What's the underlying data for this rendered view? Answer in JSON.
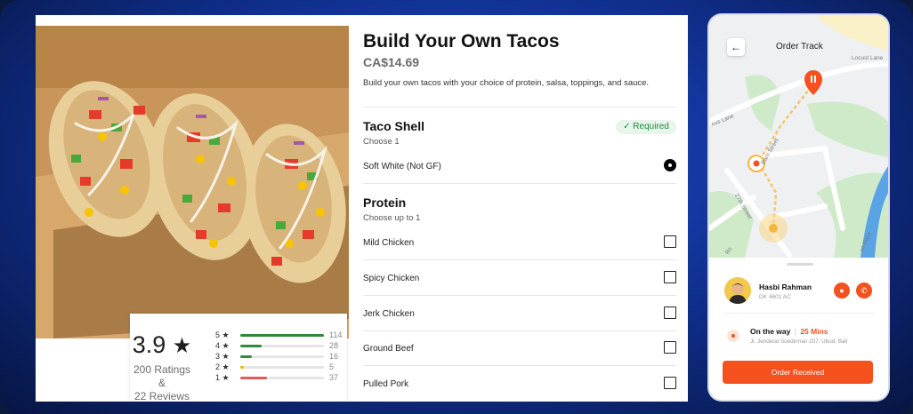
{
  "product": {
    "title": "Build Your Own Tacos",
    "price": "CA$14.69",
    "description": "Build your own tacos with your choice of protein, salsa, toppings, and sauce.",
    "image_icon": "taco-photo"
  },
  "rating": {
    "score": "3.9",
    "star": "★",
    "ratings_text": "200 Ratings &",
    "reviews_text": "22 Reviews",
    "breakdown": [
      {
        "label": "5 ★",
        "count": "114",
        "fraction": 1.0,
        "color": "#2e8b3e"
      },
      {
        "label": "4 ★",
        "count": "28",
        "fraction": 0.25,
        "color": "#2e8b3e"
      },
      {
        "label": "3 ★",
        "count": "16",
        "fraction": 0.14,
        "color": "#2e8b3e"
      },
      {
        "label": "2 ★",
        "count": "5",
        "fraction": 0.04,
        "color": "#f4b400"
      },
      {
        "label": "1 ★",
        "count": "37",
        "fraction": 0.32,
        "color": "#e55b5b"
      }
    ]
  },
  "taco_shell": {
    "title": "Taco Shell",
    "subtitle": "Choose 1",
    "badge": "✓ Required",
    "options": [
      {
        "label": "Soft White (Not GF)",
        "selected": true
      }
    ]
  },
  "protein": {
    "title": "Protein",
    "subtitle": "Choose up to 1",
    "options": [
      {
        "label": "Mild Chicken",
        "checked": false
      },
      {
        "label": "Spicy Chicken",
        "checked": false
      },
      {
        "label": "Jerk Chicken",
        "checked": false
      },
      {
        "label": "Ground Beef",
        "checked": false
      },
      {
        "label": "Pulled Pork",
        "checked": false
      }
    ]
  },
  "phone": {
    "title": "Order Track",
    "back_icon": "←",
    "streets": {
      "top_right": "Locust Lane",
      "left": "cus Lane",
      "middle": "Barn Street",
      "bottom": "27th Street",
      "bottom_left": "Ro",
      "river": "on River"
    },
    "driver": {
      "name": "Hasbi Rahman",
      "plate": "DK 4601 AC",
      "chat_icon": "chat-icon",
      "call_icon": "phone-icon"
    },
    "status": {
      "text": "On the way",
      "divider": "|",
      "eta": "25 Mins",
      "address": "Jl. Jenderal Soedirman 207, Ubud, Bali"
    },
    "button": "Order Received",
    "accent": "#f4511e"
  }
}
